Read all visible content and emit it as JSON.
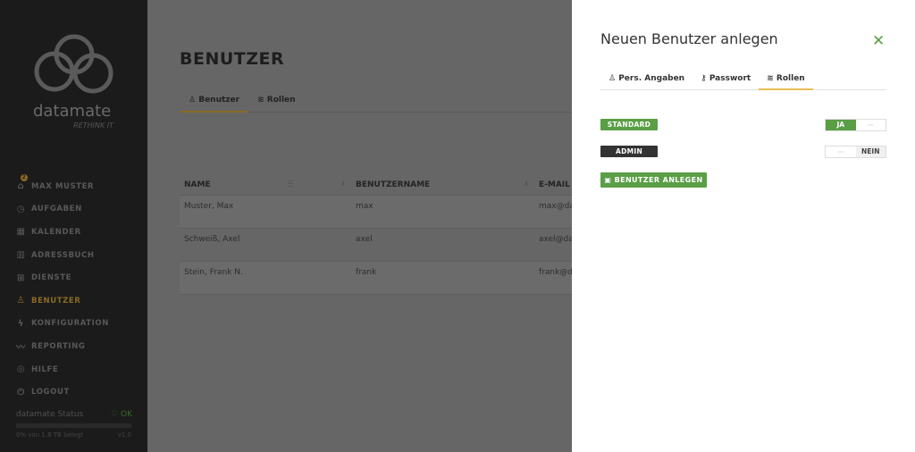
{
  "sidebar": {
    "brand": "datamate",
    "tagline": "RETHINK IT",
    "badge": "2",
    "items": [
      {
        "label": "MAX MUSTER",
        "icon": "home-icon"
      },
      {
        "label": "AUFGABEN",
        "icon": "stopwatch-icon"
      },
      {
        "label": "KALENDER",
        "icon": "calendar-icon"
      },
      {
        "label": "ADRESSBUCH",
        "icon": "book-icon"
      },
      {
        "label": "DIENSTE",
        "icon": "grid-icon"
      },
      {
        "label": "BENUTZER",
        "icon": "users-icon"
      },
      {
        "label": "KONFIGURATION",
        "icon": "bolt-icon"
      },
      {
        "label": "REPORTING",
        "icon": "chart-line-icon"
      },
      {
        "label": "HILFE",
        "icon": "lifebuoy-icon"
      },
      {
        "label": "LOGOUT",
        "icon": "power-icon"
      }
    ],
    "status": {
      "label": "datamate Status",
      "ok": "♡ OK",
      "usage": "0% von 1.8 TB belegt",
      "usage_percent": 0,
      "version": "v1.0"
    }
  },
  "main": {
    "title": "BENUTZER",
    "tabs": [
      {
        "label": "Benutzer"
      },
      {
        "label": "Rollen"
      }
    ],
    "table": {
      "headers": [
        "NAME",
        "BENUTZERNAME",
        "E-MAIL"
      ],
      "rows": [
        [
          "Muster, Max",
          "max",
          "max@da"
        ],
        [
          "Schweiß, Axel",
          "axel",
          "axel@da"
        ],
        [
          "Stein, Frank N.",
          "frank",
          "frank@da"
        ]
      ]
    }
  },
  "panel": {
    "title": "Neuen Benutzer anlegen",
    "tabs": [
      {
        "label": "Pers. Angaben"
      },
      {
        "label": "Passwort"
      },
      {
        "label": "Rollen"
      }
    ],
    "roles": [
      {
        "label": "STANDARD",
        "value": "JA",
        "on": true
      },
      {
        "label": "ADMIN",
        "value": "NEIN",
        "on": false
      }
    ],
    "submit": "BENUTZER ANLEGEN"
  },
  "colors": {
    "accent": "#5a9e46",
    "highlight": "#e8bd55",
    "dark": "#333333"
  }
}
